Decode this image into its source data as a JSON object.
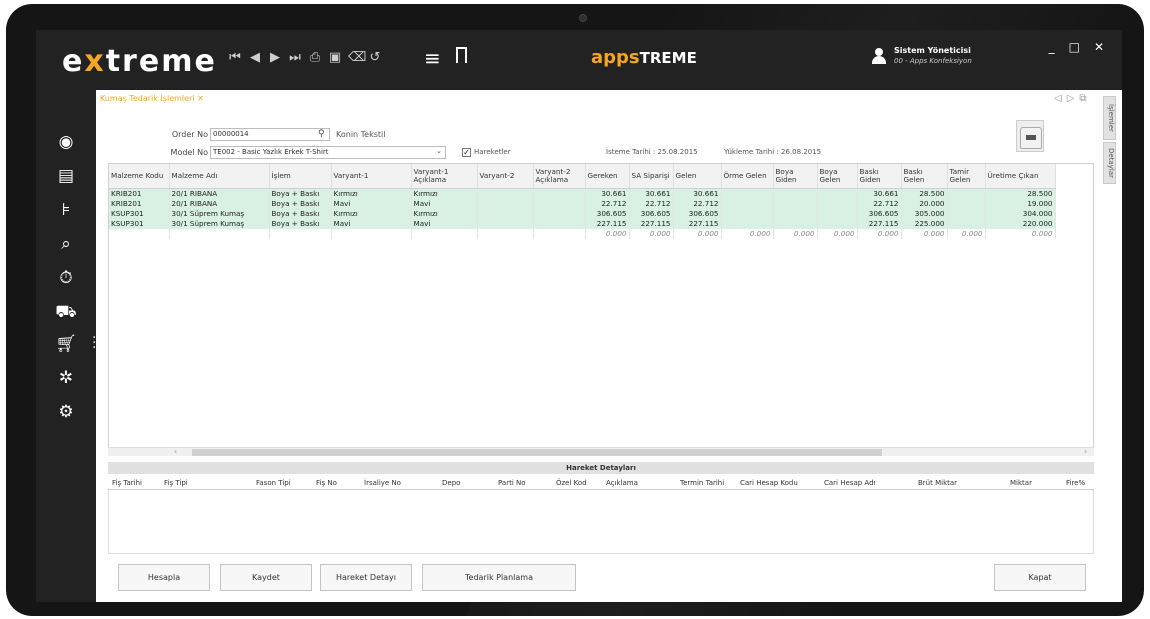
{
  "app": {
    "logo": "extreme",
    "logo_x": "x",
    "apps_logo_a": "apps",
    "apps_logo_b": "TREME"
  },
  "user": {
    "name": "Sistem Yöneticisi",
    "company": "00 - Apps Konfeksiyon"
  },
  "window": {
    "minimize": "_",
    "maximize": "□",
    "close": "✕"
  },
  "tab": {
    "label": "Kumaş Tedarik İşlemleri  ✕"
  },
  "right_tabs": [
    "İşlemler",
    "Detaylar"
  ],
  "form": {
    "order_no_label": "Order No",
    "order_no_value": "00000014",
    "company": "Konin Tekstil",
    "model_no_label": "Model No",
    "model_no_value": "TE002 - Basic Yazlık Erkek T-Shirt",
    "hareketler_label": "Hareketler",
    "istem_tarihi": "İsteme Tarihi : 25.08.2015",
    "yukleme_tarihi": "Yükleme Tarihi : 26.08.2015"
  },
  "grid": {
    "headers": [
      "Malzeme Kodu",
      "Malzeme Adı",
      "İşlem",
      "Varyant-1",
      "Varyant-1 Açıklama",
      "Varyant-2",
      "Varyant-2 Açıklama",
      "Gereken",
      "SA Siparişi",
      "Gelen",
      "Örme Gelen",
      "Boya Giden",
      "Boya Gelen",
      "Baskı Giden",
      "Baskı Gelen",
      "Tamir Gelen",
      "Üretime Çıkan"
    ],
    "rows": [
      [
        "KRIB201",
        "20/1 RIBANA",
        "Boya + Baskı",
        "Kırmızı",
        "Kırmızı",
        "",
        "",
        "30.661",
        "30.661",
        "30.661",
        "",
        "",
        "",
        "30.661",
        "28.500",
        "",
        "28.500"
      ],
      [
        "KRIB201",
        "20/1 RIBANA",
        "Boya + Baskı",
        "Mavi",
        "Mavi",
        "",
        "",
        "22.712",
        "22.712",
        "22.712",
        "",
        "",
        "",
        "22.712",
        "20.000",
        "",
        "19.000"
      ],
      [
        "KSUP301",
        "30/1 Süprem Kumaş",
        "Boya + Baskı",
        "Kırmızı",
        "Kırmızı",
        "",
        "",
        "306.605",
        "306.605",
        "306.605",
        "",
        "",
        "",
        "306.605",
        "305.000",
        "",
        "304.000"
      ],
      [
        "KSUP301",
        "30/1 Süprem Kumaş",
        "Boya + Baskı",
        "Mavi",
        "Mavi",
        "",
        "",
        "227.115",
        "227.115",
        "227.115",
        "",
        "",
        "",
        "227.115",
        "225.000",
        "",
        "220.000"
      ]
    ],
    "totals": [
      "",
      "",
      "",
      "",
      "",
      "",
      "",
      "0.000",
      "0.000",
      "0.000",
      "0.000",
      "0.000",
      "0.000",
      "0.000",
      "0.000",
      "0.000",
      "0.000"
    ]
  },
  "details": {
    "title": "Hareket Detayları",
    "columns": [
      "Fiş Tarihi",
      "Fiş Tipi",
      "Fason Tipi",
      "Fiş No",
      "İrsaliye No",
      "Depo",
      "Parti No",
      "Özel Kod",
      "Açıklama",
      "Termin Tarihi",
      "Cari Hesap Kodu",
      "Cari Hesap Adı",
      "Brüt Miktar",
      "Miktar",
      "Fire%"
    ]
  },
  "buttons": {
    "hesapla": "Hesapla",
    "kaydet": "Kaydet",
    "hareket_detayi": "Hareket Detayı",
    "tedarik_planlama": "Tedarik Planlama",
    "kapat": "Kapat"
  },
  "colors": {
    "accent": "#f5a623",
    "row_highlight": "#d8f1e2",
    "topbar": "#222222"
  },
  "icons": [
    "first-record-icon",
    "prev-record-icon",
    "next-record-icon",
    "last-record-icon",
    "print-icon",
    "save-icon",
    "delete-icon",
    "undo-icon",
    "menu-icon",
    "bookmark-icon",
    "user-icon",
    "target-icon",
    "document-icon",
    "tree-icon",
    "search-icon",
    "stopwatch-icon",
    "forklift-icon",
    "cart-icon",
    "network-icon",
    "gear-icon"
  ]
}
